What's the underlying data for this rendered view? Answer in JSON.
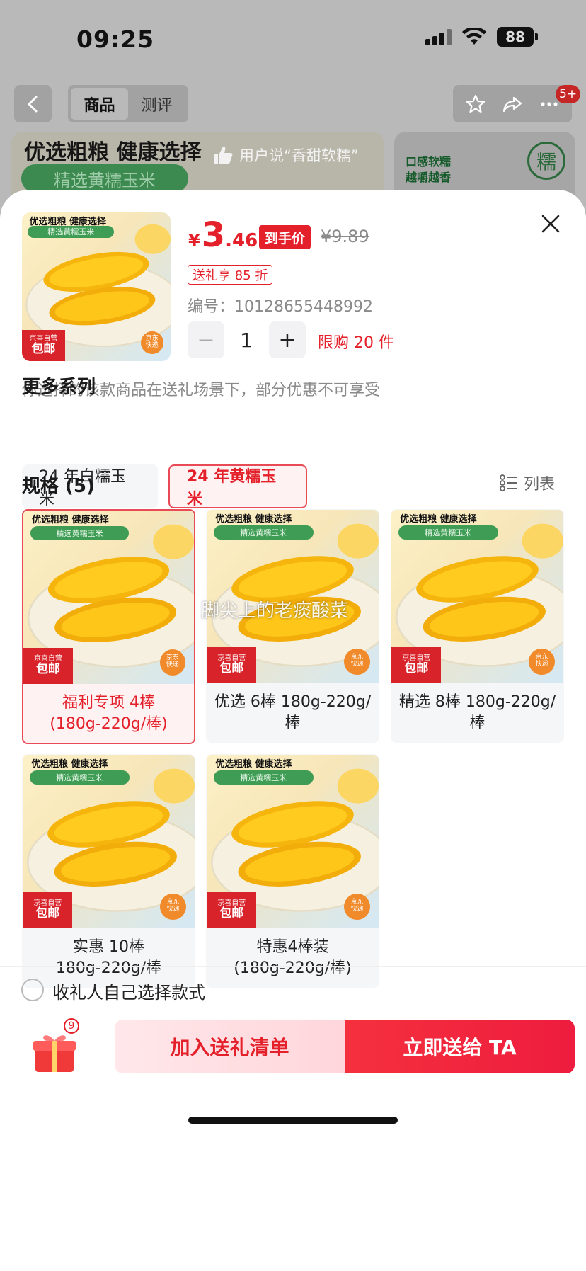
{
  "status_bar": {
    "time": "09:25",
    "battery": "88"
  },
  "nav": {
    "tabs": [
      {
        "label": "商品"
      },
      {
        "label": "测评"
      }
    ],
    "badge": "5+"
  },
  "banner": {
    "title": "优选粗粮 健康选择",
    "subtitle": "精选黄糯玉米",
    "review": "用户说“香甜软糯”",
    "right_text_1": "口感软糯",
    "right_text_2": "越嚼越香",
    "right_logo": "糯"
  },
  "product": {
    "price_symbol": "¥",
    "price_int": "3",
    "price_dec": ".46",
    "price_tag": "到手价",
    "price_original": "¥9.89",
    "discount": "送礼享 85 折",
    "sku": "编号：10128655448992",
    "quantity": "1",
    "minus": "−",
    "plus": "+",
    "limit": "限购 20 件",
    "gift_note": "你选择的该款商品在送礼场景下，部分优惠不可享受"
  },
  "image_text": {
    "title": "优选粗粮 健康选择",
    "sub": "精选黄糯玉米",
    "jd_small": "京喜自营",
    "jd_big": "包邮",
    "express": "京东\n快递"
  },
  "series": {
    "title": "更多系列",
    "options": [
      {
        "label": "24 年白糯玉米"
      },
      {
        "label": "24 年黄糯玉米"
      }
    ],
    "selected_index": 1
  },
  "specs": {
    "title": "规格 (5)",
    "list_label": "列表",
    "watermark": "脚尖上的老痰酸菜",
    "items": [
      {
        "label": "福利专项 4棒\n(180g-220g/棒)"
      },
      {
        "label": "优选 6棒 180g-220g/\n棒"
      },
      {
        "label": "精选 8棒 180g-220g/\n棒"
      },
      {
        "label": "实惠 10棒\n180g-220g/棒"
      },
      {
        "label": "特惠4棒装\n(180g-220g/棒)"
      }
    ],
    "selected_index": 0
  },
  "footer": {
    "receiver_label": "收礼人自己选择款式",
    "cart_count": "9",
    "add_button": "加入送礼清单",
    "send_button": "立即送给 TA"
  },
  "colors": {
    "accent": "#e4202a",
    "selected_bg": "#fff2f3",
    "card_bg": "#f5f6f8"
  }
}
